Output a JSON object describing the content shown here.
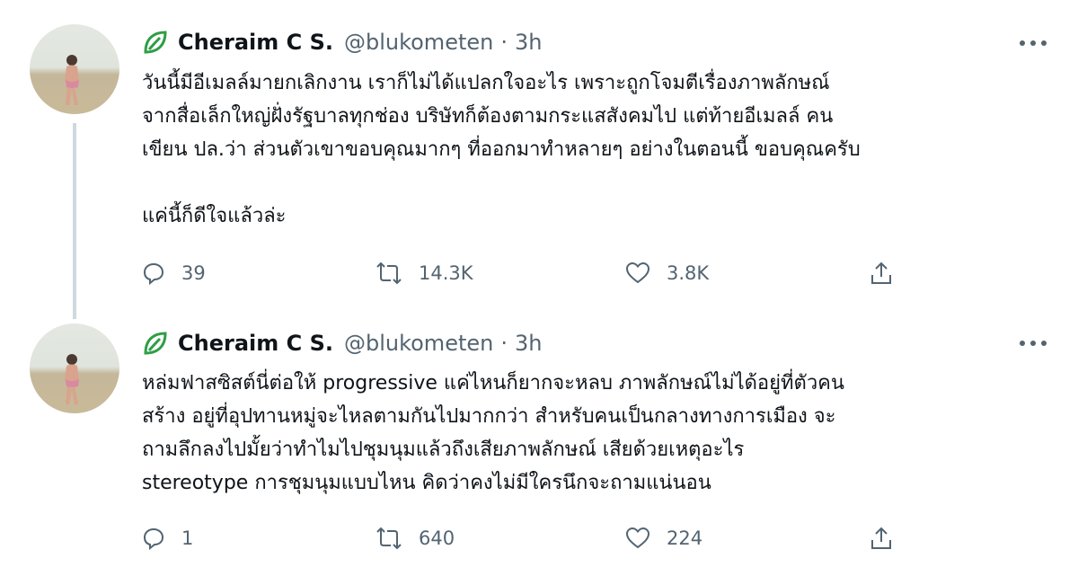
{
  "tweets": [
    {
      "name": "Cheraim C S.",
      "handle": "@blukometen",
      "separator": "·",
      "time": "3h",
      "lines": [
        "วันนี้มีอีเมลล์มายกเลิกงาน เราก็ไม่ได้แปลกใจอะไร เพราะถูกโจมตีเรื่องภาพลักษณ์",
        "จากสื่อเล็กใหญ่ฝั่งรัฐบาลทุกช่อง บริษัทก็ต้องตามกระแสสังคมไป แต่ท้ายอีเมลล์ คน",
        "เขียน ปล.ว่า ส่วนตัวเขาขอบคุณมากๆ ที่ออกมาทำหลายๆ อย่างในตอนนี้ ขอบคุณครับ",
        "แค่นี้ก็ดีใจแล้วล่ะ"
      ],
      "replies": "39",
      "retweets": "14.3K",
      "likes": "3.8K"
    },
    {
      "name": "Cheraim C S.",
      "handle": "@blukometen",
      "separator": "·",
      "time": "3h",
      "lines": [
        "หล่มฟาสซิสต์นี่ต่อให้ progressive แค่ไหนก็ยากจะหลบ ภาพลักษณ์ไม่ได้อยู่ที่ตัวคน",
        "สร้าง อยู่ที่อุปทานหมู่จะไหลตามกันไปมากกว่า สำหรับคนเป็นกลางทางการเมือง จะ",
        "ถามลึกลงไปมั้ยว่าทำไมไปชุมนุมแล้วถึงเสียภาพลักษณ์ เสียด้วยเหตุอะไร",
        "stereotype การชุมนุมแบบไหน คิดว่าคงไม่มีใครนึกจะถามแน่นอน"
      ],
      "replies": "1",
      "retweets": "640",
      "likes": "224"
    }
  ],
  "icons": {
    "verified": "leaf-badge-icon",
    "more": "more-dots-icon",
    "reply": "reply-icon",
    "retweet": "retweet-icon",
    "like": "heart-icon",
    "share": "share-icon"
  },
  "colors": {
    "text": "#0f1419",
    "secondary": "#536471",
    "badge": "#2e9e45",
    "thread_line": "#cfd9de"
  }
}
